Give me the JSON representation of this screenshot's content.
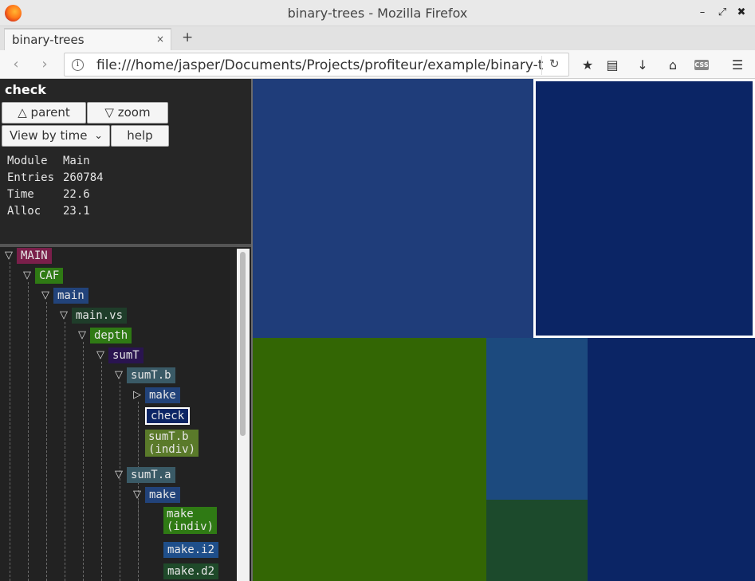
{
  "window": {
    "title": "binary-trees - Mozilla Firefox",
    "minimize": "–",
    "restore": "⤢",
    "close": "✖"
  },
  "tabs": [
    {
      "label": "binary-trees",
      "close": "×"
    }
  ],
  "new_tab": "+",
  "nav": {
    "back": "‹",
    "forward": "›",
    "info": "i",
    "url": "file:///home/jasper/Documents/Projects/profiteur/example/binary-trees.html",
    "reload": "↻",
    "bookmark": "★",
    "library": "▤",
    "download": "↓",
    "home": "⌂",
    "css": "CSS",
    "menu": "☰"
  },
  "panel": {
    "node_name": "check",
    "parent_label": "△ parent",
    "zoom_label": "▽ zoom",
    "view_select": "View by time",
    "help_label": "help",
    "stats": [
      {
        "key": "Module",
        "value": "Main"
      },
      {
        "key": "Entries",
        "value": "260784"
      },
      {
        "key": "Time",
        "value": "22.6"
      },
      {
        "key": "Alloc",
        "value": "23.1"
      }
    ]
  },
  "tree": [
    {
      "label": "MAIN",
      "toggle": "▽",
      "color": "#7a1f4a"
    },
    {
      "label": "CAF",
      "toggle": "▽",
      "color": "#2f7a14"
    },
    {
      "label": "main",
      "toggle": "▽",
      "color": "#22437a"
    },
    {
      "label": "main.vs",
      "toggle": "▽",
      "color": "#1f3d2a"
    },
    {
      "label": "depth",
      "toggle": "▽",
      "color": "#2f7a14"
    },
    {
      "label": "sumT",
      "toggle": "▽",
      "color": "#2a1450"
    },
    {
      "label": "sumT.b",
      "toggle": "▽",
      "color": "#3a5a66"
    },
    {
      "label": "make",
      "toggle": "▷",
      "color": "#22437a"
    },
    {
      "label": "check",
      "toggle": "",
      "color": "#0b2565",
      "selected": true
    },
    {
      "label": "sumT.b\n(indiv)",
      "toggle": "",
      "color": "#5a7a2a"
    },
    {
      "label": "sumT.a",
      "toggle": "▽",
      "color": "#3a5a66"
    },
    {
      "label": "make",
      "toggle": "▽",
      "color": "#22437a"
    },
    {
      "label": "make\n(indiv)",
      "toggle": "",
      "color": "#2f7a14"
    },
    {
      "label": "make.i2",
      "toggle": "",
      "color": "#1f4f8a"
    },
    {
      "label": "make.d2",
      "toggle": "",
      "color": "#1f4a2a"
    }
  ],
  "treemap_colors": {
    "background": "#1f3d7a",
    "check": "#0b2565",
    "sumT_b_indiv": "#336604",
    "make_i2": "#1c4a7e",
    "make_d2": "#1c4a2c",
    "right_block": "#0b2565",
    "selection_border": "#ffffff"
  }
}
